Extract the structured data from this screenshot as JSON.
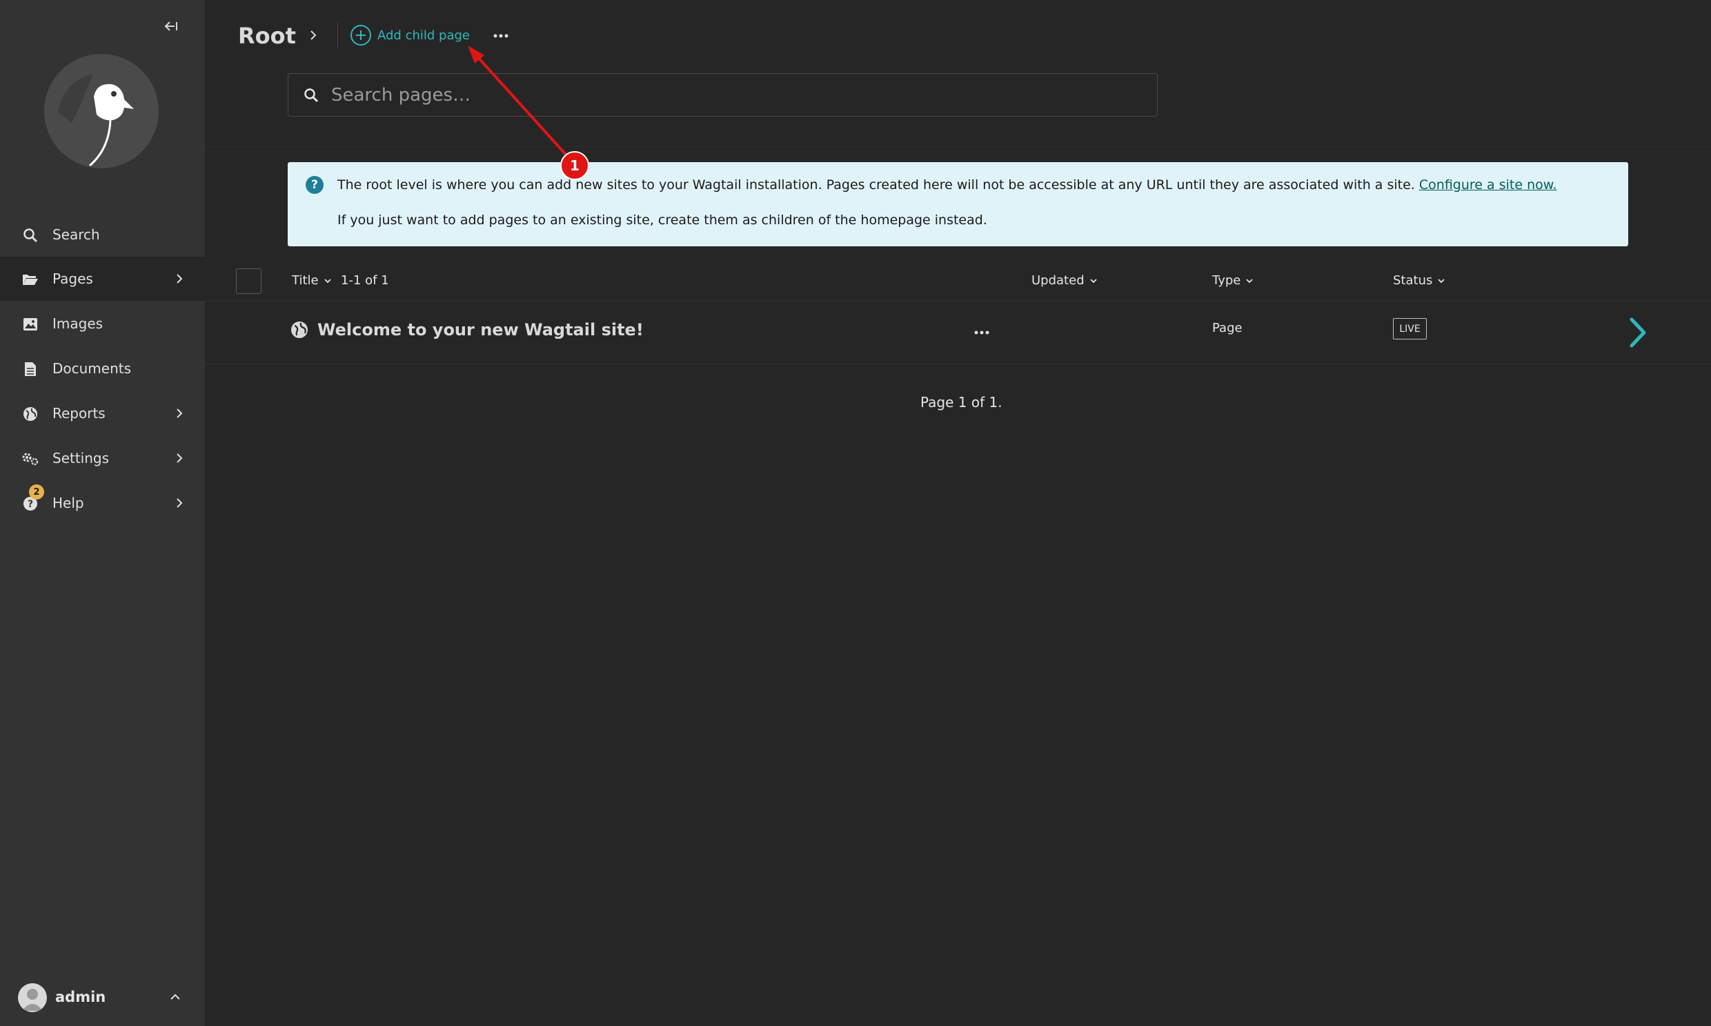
{
  "sidebar": {
    "collapse_icon": "collapse-left-icon",
    "logo": "wagtail-bird-logo",
    "items": [
      {
        "label": "Search",
        "icon": "search-icon"
      },
      {
        "label": "Pages",
        "icon": "folder-open-icon"
      },
      {
        "label": "Images",
        "icon": "image-icon"
      },
      {
        "label": "Documents",
        "icon": "document-icon"
      },
      {
        "label": "Reports",
        "icon": "globe-icon"
      },
      {
        "label": "Settings",
        "icon": "cogs-icon"
      },
      {
        "label": "Help",
        "icon": "help-icon",
        "badge": "2"
      }
    ],
    "account": {
      "name": "admin"
    }
  },
  "header": {
    "title": "Root",
    "add_child_label": "Add child page"
  },
  "search": {
    "placeholder": "Search pages…"
  },
  "help": {
    "line1": "The root level is where you can add new sites to your Wagtail installation. Pages created here will not be accessible at any URL until they are associated with a site.",
    "link": "Configure a site now.",
    "line2": "If you just want to add pages to an existing site, create them as children of the homepage instead."
  },
  "table": {
    "columns": {
      "title": "Title",
      "count": "1-1 of 1",
      "updated": "Updated",
      "type": "Type",
      "status": "Status"
    },
    "rows": [
      {
        "title": "Welcome to your new Wagtail site!",
        "updated": "",
        "type": "Page",
        "status": "LIVE"
      }
    ]
  },
  "pagination": "Page 1 of 1.",
  "annotation": {
    "badge": "1",
    "color": "#e11414"
  },
  "colors": {
    "accent": "#2fb8bd",
    "sidebar": "#333333",
    "background": "#262626",
    "help_bg": "#e0f3f8"
  }
}
